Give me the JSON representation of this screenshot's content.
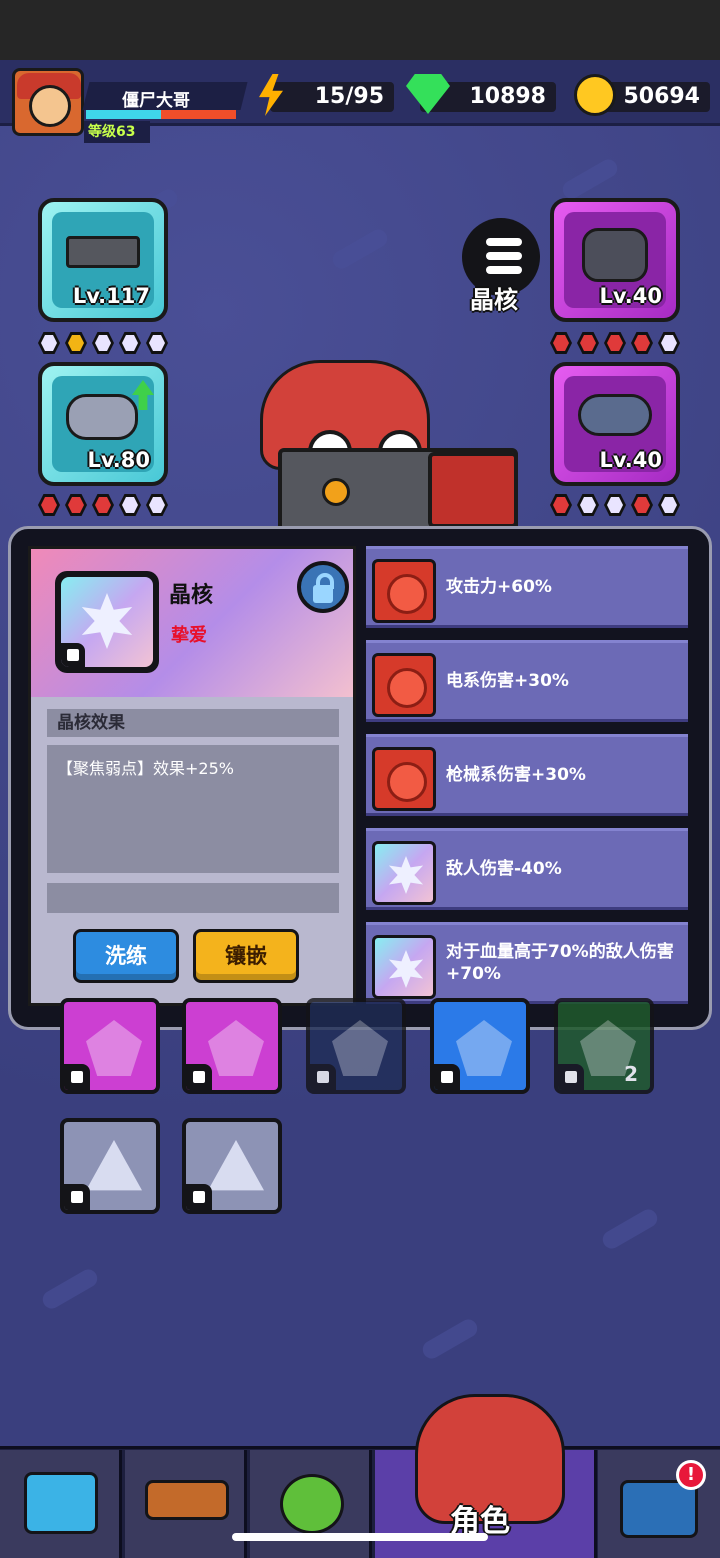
{
  "player": {
    "name": "僵尸大哥",
    "level_label": "等级63",
    "xp_fraction": 0.5
  },
  "resources": {
    "energy": "15/95",
    "gems": "10898",
    "coins": "50694"
  },
  "equipment": {
    "weapon_level": "Lv.117",
    "necklace_level": "Lv.80",
    "armor_level": "Lv.40",
    "ring_level": "Lv.40"
  },
  "core_menu_label": "晶核",
  "core_panel": {
    "title": "晶核",
    "name": "挚爱",
    "effect_section_label": "晶核效果",
    "effect_text": "【聚焦弱点】效果+25%",
    "refine_button": "洗练",
    "inlay_button": "镶嵌"
  },
  "attributes": [
    {
      "text": "攻击力+60%",
      "icon": "red-gem-icon"
    },
    {
      "text": "电系伤害+30%",
      "icon": "red-gem-icon"
    },
    {
      "text": "枪械系伤害+30%",
      "icon": "red-gem-icon"
    },
    {
      "text": "敌人伤害-40%",
      "icon": "star-core-icon"
    },
    {
      "text": "对于血量高于70%的敌人伤害+70%",
      "icon": "star-core-icon"
    }
  ],
  "inventory": {
    "stack_count": "2"
  },
  "nav": {
    "active_label": "角色",
    "alert_badge": "!"
  },
  "colors": {
    "background": "#3a3f7e",
    "attribute_row": "#6c6ab6",
    "refine": "#2d8ce0",
    "inlay": "#f4b31c",
    "rarity_red": "#e03a3a"
  }
}
